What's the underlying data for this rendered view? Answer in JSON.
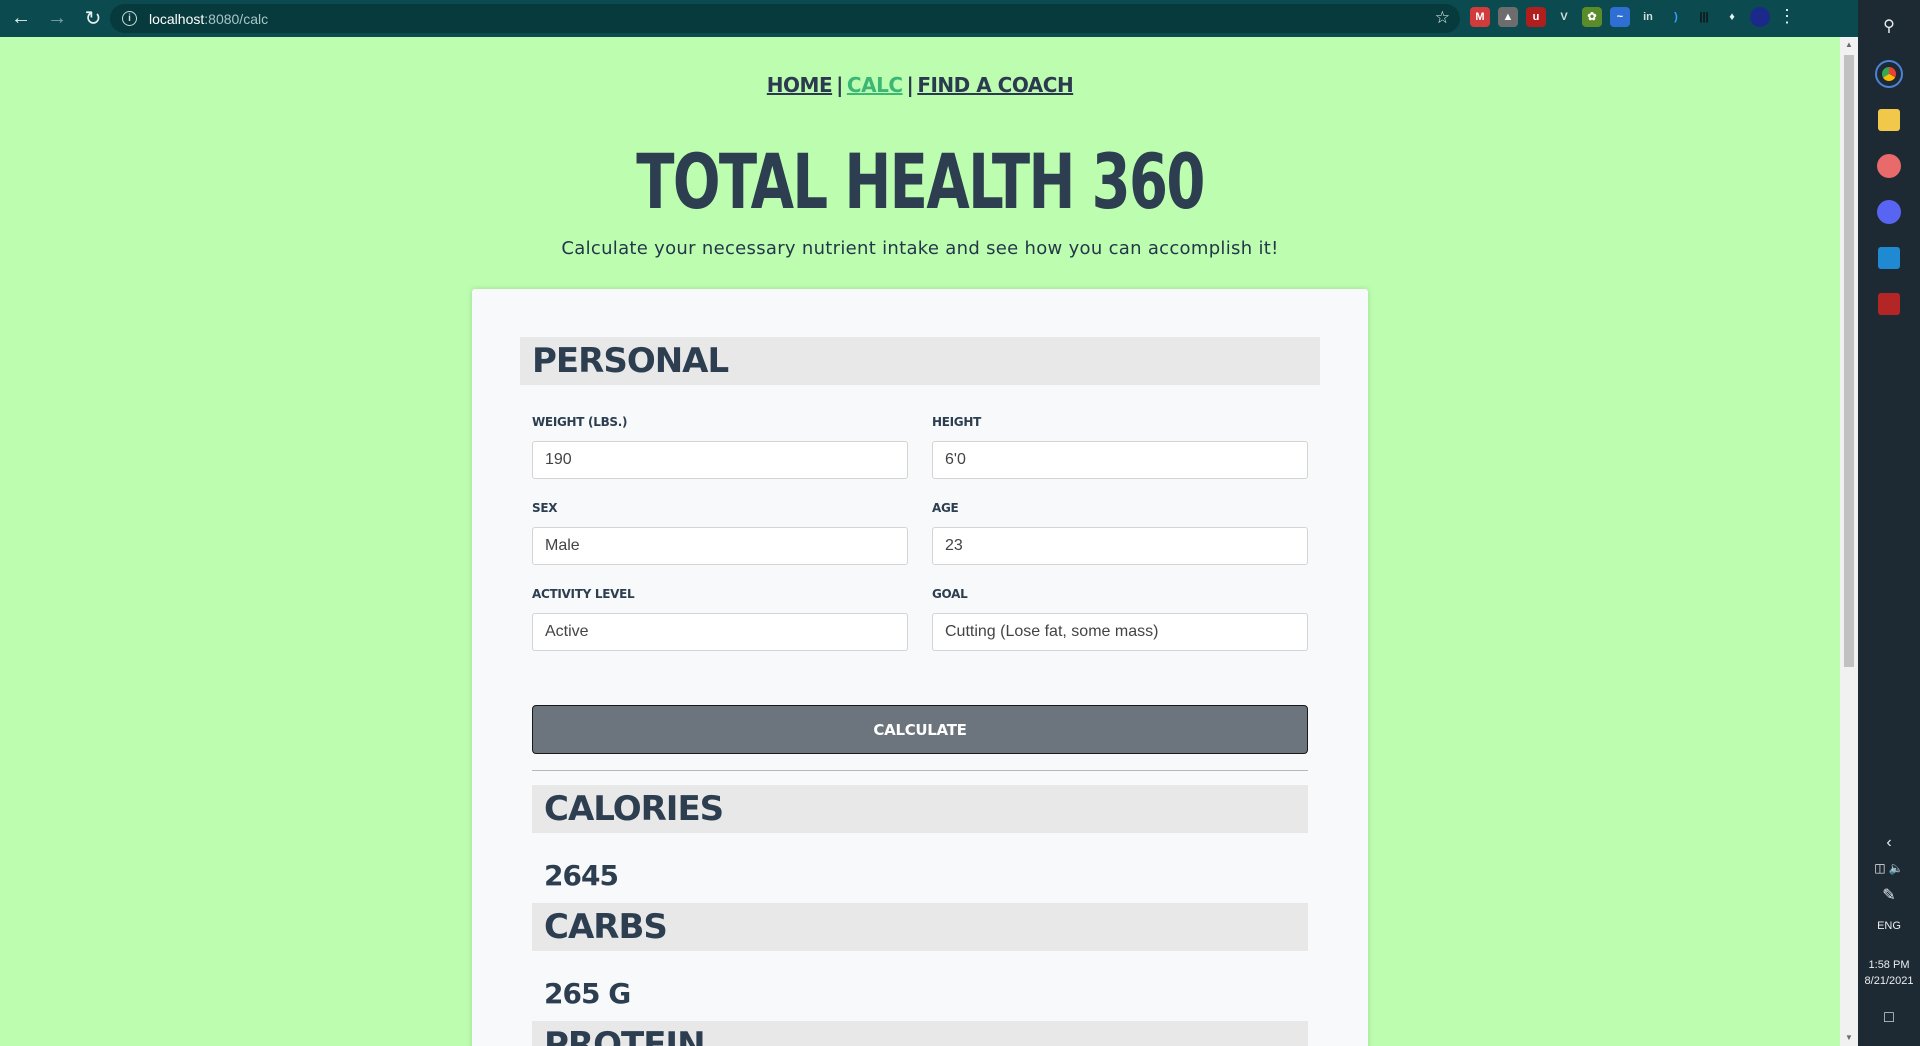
{
  "browser": {
    "url_host": "localhost",
    "url_path": ":8080/calc"
  },
  "nav": {
    "items": [
      {
        "label": "HOME"
      },
      {
        "label": "CALC"
      },
      {
        "label": "FIND A COACH"
      }
    ],
    "separator": "|"
  },
  "header": {
    "title": "TOTAL HEALTH 360",
    "subtitle": "Calculate your necessary nutrient intake and see how you can accomplish it!"
  },
  "personal": {
    "heading": "PERSONAL",
    "fields": {
      "weight": {
        "label": "WEIGHT (LBS.)",
        "value": "190"
      },
      "height": {
        "label": "HEIGHT",
        "value": "6'0"
      },
      "sex": {
        "label": "SEX",
        "value": "Male"
      },
      "age": {
        "label": "AGE",
        "value": "23"
      },
      "activity": {
        "label": "ACTIVITY LEVEL",
        "value": "Active"
      },
      "goal": {
        "label": "GOAL",
        "value": "Cutting (Lose fat, some mass)"
      }
    },
    "calculate_label": "CALCULATE"
  },
  "results": {
    "calories": {
      "heading": "CALORIES",
      "value": "2645"
    },
    "carbs": {
      "heading": "CARBS",
      "value": "265 G"
    },
    "protein": {
      "heading": "PROTEIN"
    }
  },
  "taskbar": {
    "language": "ENG",
    "time": "1:58 PM",
    "date": "8/21/2021"
  },
  "colors": {
    "page_background": "#bdfdb0",
    "browser_chrome": "#0b4a4e",
    "accent_active_nav": "#3cb675",
    "heading_text": "#2c3e50",
    "button": "#6c757d"
  },
  "icons": {
    "back": "arrow-left-icon",
    "forward": "arrow-right-icon",
    "reload": "reload-icon",
    "info": "info-icon",
    "bookmark": "star-icon",
    "extensions": "puzzle-icon",
    "menu": "kebab-menu-icon"
  }
}
